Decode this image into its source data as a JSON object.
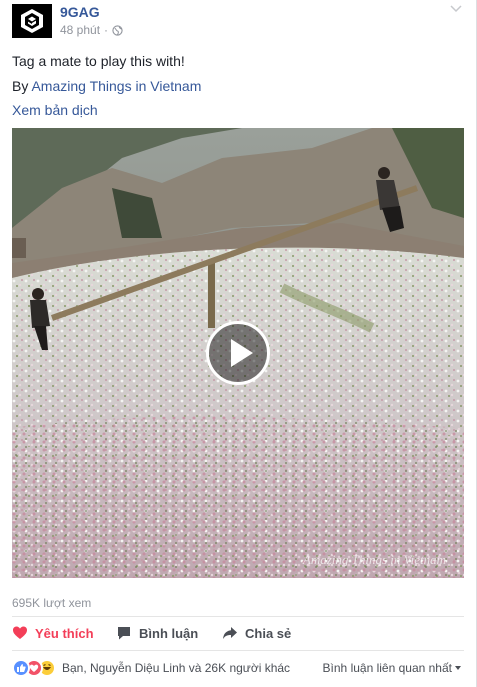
{
  "post": {
    "page_name": "9GAG",
    "time": "48 phút",
    "separator": "·",
    "privacy_icon": "globe-icon",
    "menu_icon": "chevron-down-icon",
    "text": "Tag a mate to play this with!",
    "byline_prefix": "By ",
    "byline_link": "Amazing Things in Vietnam",
    "translate_link": "Xem bản dịch"
  },
  "video": {
    "watermark": "Amazing Things in Vietnam",
    "play_icon": "play-icon",
    "views": "695K lượt xem"
  },
  "actions": {
    "like_label": "Yêu thích",
    "comment_label": "Bình luận",
    "share_label": "Chia sẻ",
    "like_color": "#f33e58"
  },
  "reactions": {
    "icons": [
      "like-reaction-icon",
      "love-reaction-icon",
      "haha-reaction-icon"
    ],
    "summary": "Bạn, Nguyễn Diệu Linh và 26K người khác",
    "sort_label": "Bình luận liên quan nhất"
  },
  "colors": {
    "link": "#365899",
    "meta": "#90949c",
    "text": "#1d2129"
  }
}
